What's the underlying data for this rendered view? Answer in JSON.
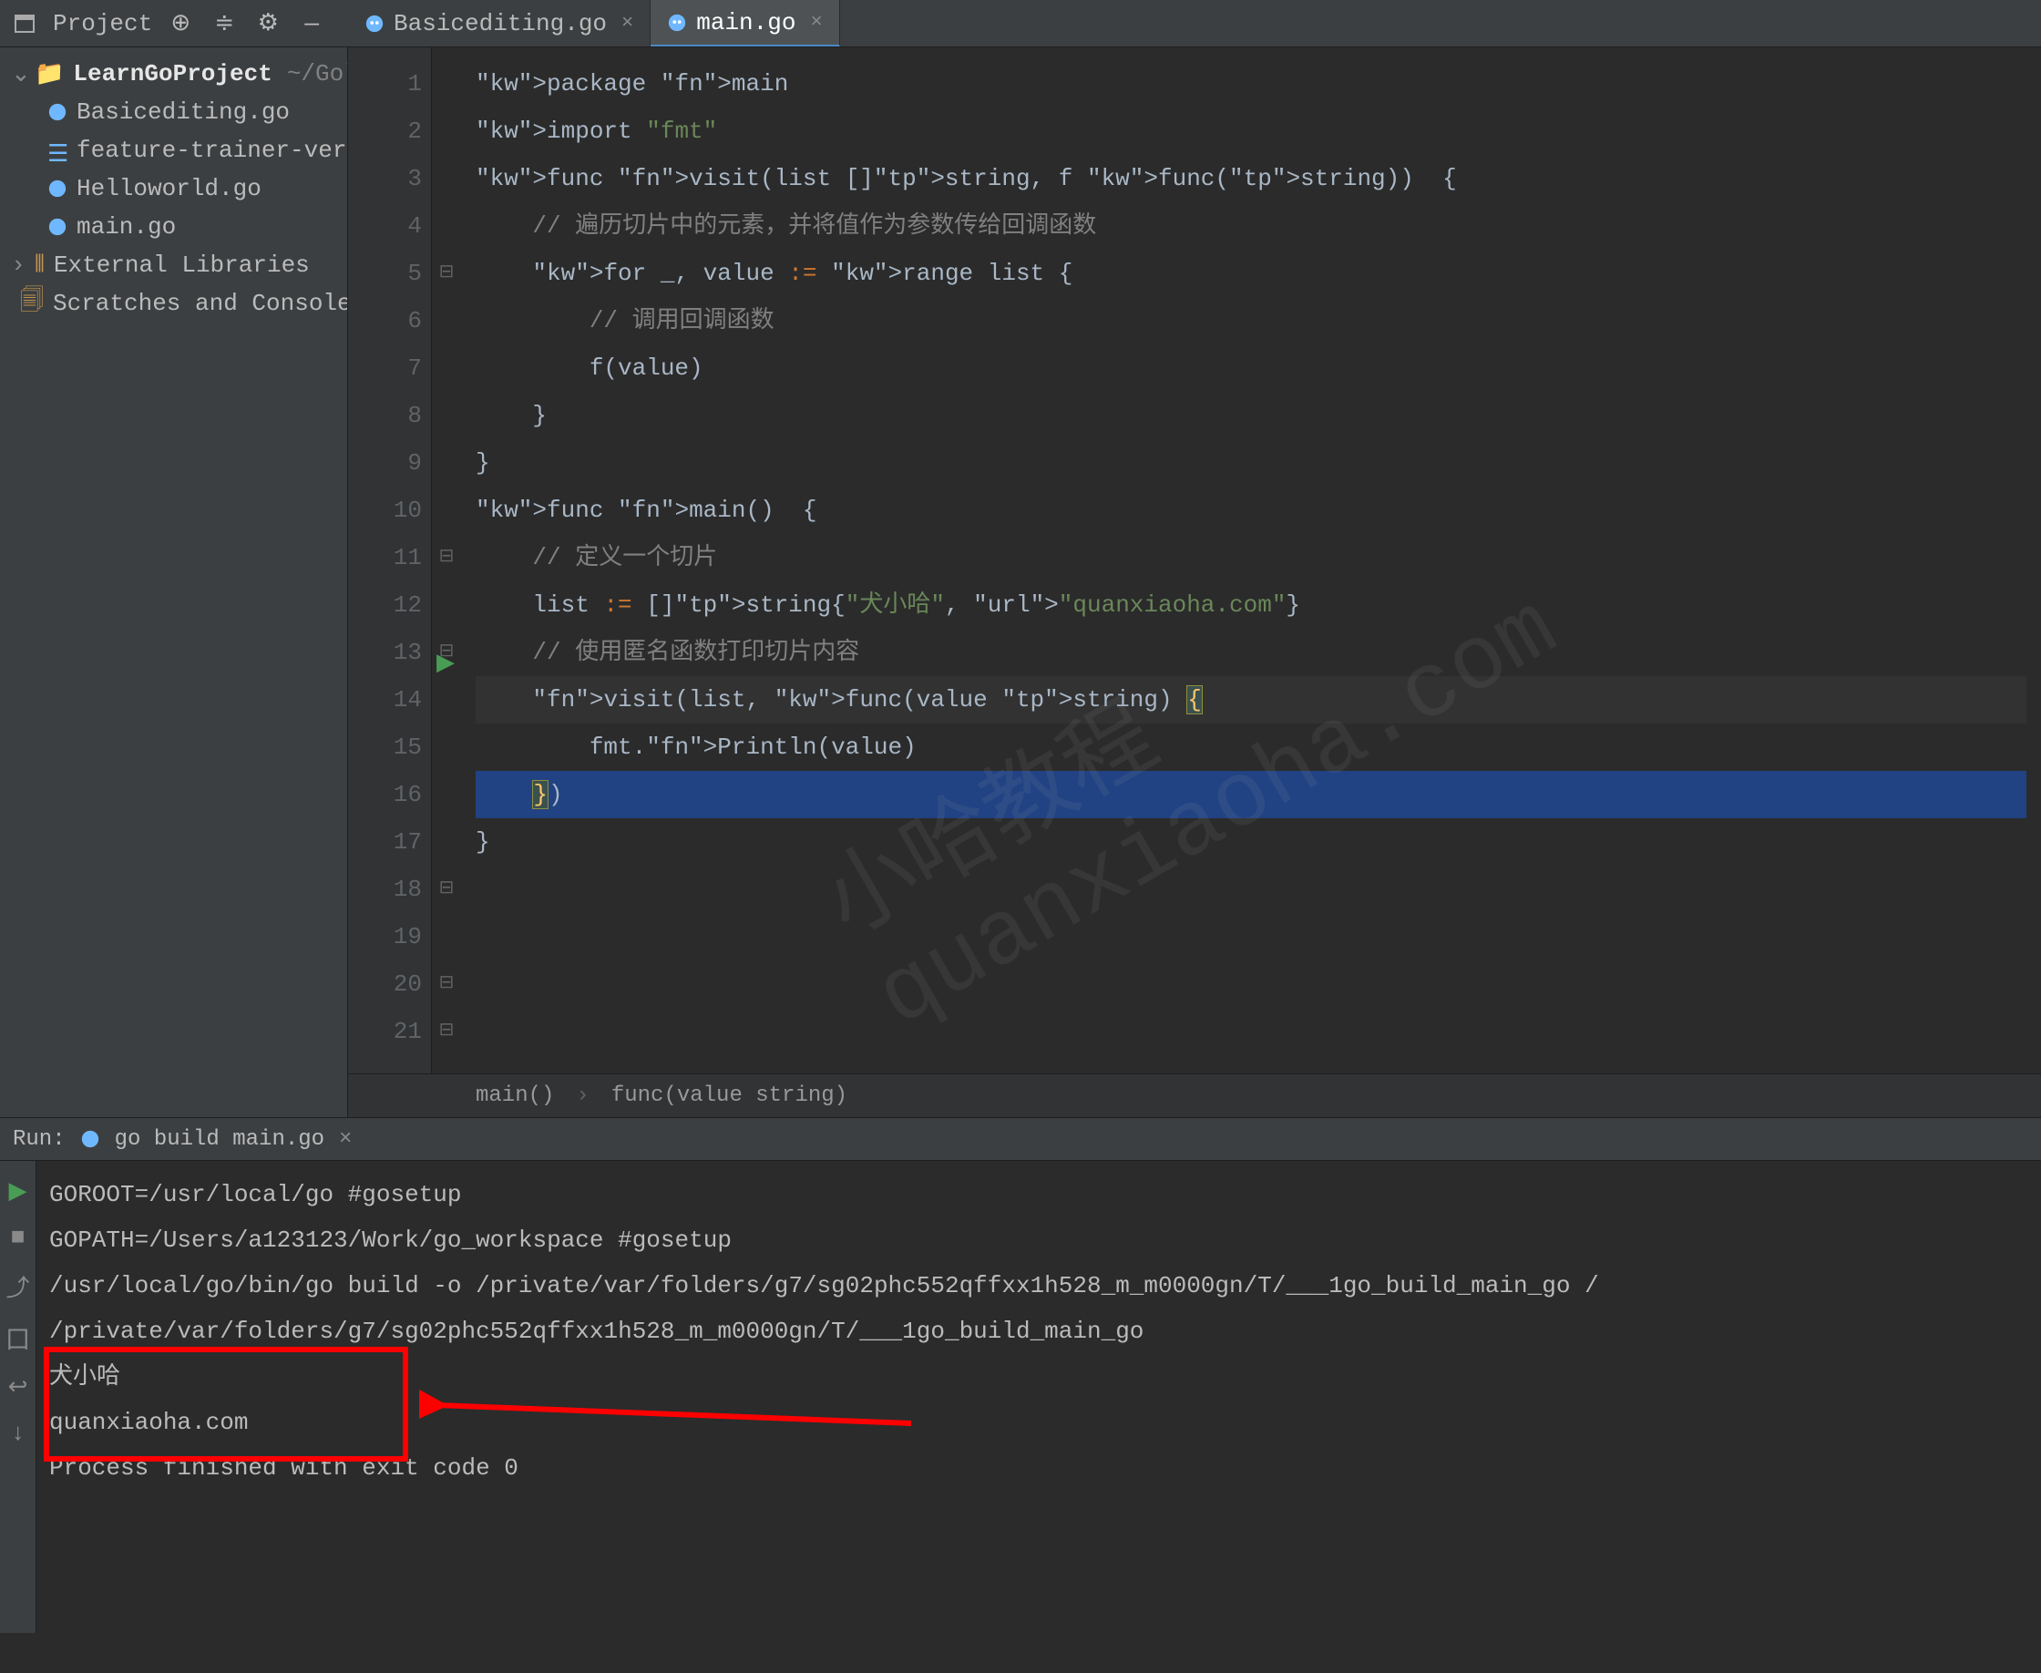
{
  "toolbar": {
    "project_label": "Project"
  },
  "tabs": [
    {
      "label": "Basicediting.go",
      "active": false
    },
    {
      "label": "main.go",
      "active": true
    }
  ],
  "tree": {
    "root": {
      "name": "LearnGoProject",
      "path": "~/Gola"
    },
    "files": [
      {
        "label": "Basicediting.go",
        "icon": "go"
      },
      {
        "label": "feature-trainer-versio",
        "icon": "list"
      },
      {
        "label": "Helloworld.go",
        "icon": "go"
      },
      {
        "label": "main.go",
        "icon": "go"
      }
    ],
    "ext_lib": "External Libraries",
    "scratches": "Scratches and Consoles"
  },
  "code": {
    "lines": [
      "package main",
      "",
      "import \"fmt\"",
      "",
      "func visit(list []string, f func(string))  {",
      "    // 遍历切片中的元素，并将值作为参数传给回调函数",
      "    for _, value := range list {",
      "        // 调用回调函数",
      "        f(value)",
      "    }",
      "}",
      "",
      "func main()  {",
      "    // 定义一个切片",
      "    list := []string{\"犬小哈\", \"quanxiaoha.com\"}",
      "",
      "    // 使用匿名函数打印切片内容",
      "    visit(list, func(value string) {",
      "        fmt.Println(value)",
      "    })",
      "}"
    ],
    "line_numbers": [
      "1",
      "2",
      "3",
      "4",
      "5",
      "6",
      "7",
      "8",
      "9",
      "10",
      "11",
      "12",
      "13",
      "14",
      "15",
      "16",
      "17",
      "18",
      "19",
      "20",
      "21"
    ]
  },
  "breadcrumb": {
    "a": "main()",
    "b": "func(value string)"
  },
  "run": {
    "label": "Run:",
    "config": "go build main.go",
    "output": [
      "GOROOT=/usr/local/go #gosetup",
      "GOPATH=/Users/a123123/Work/go_workspace #gosetup",
      "/usr/local/go/bin/go build -o /private/var/folders/g7/sg02phc552qffxx1h528_m_m0000gn/T/___1go_build_main_go /",
      "/private/var/folders/g7/sg02phc552qffxx1h528_m_m0000gn/T/___1go_build_main_go",
      "犬小哈",
      "quanxiaoha.com",
      "",
      "Process finished with exit code 0"
    ]
  },
  "watermark": "小哈教程\nquanxiaoha.com"
}
